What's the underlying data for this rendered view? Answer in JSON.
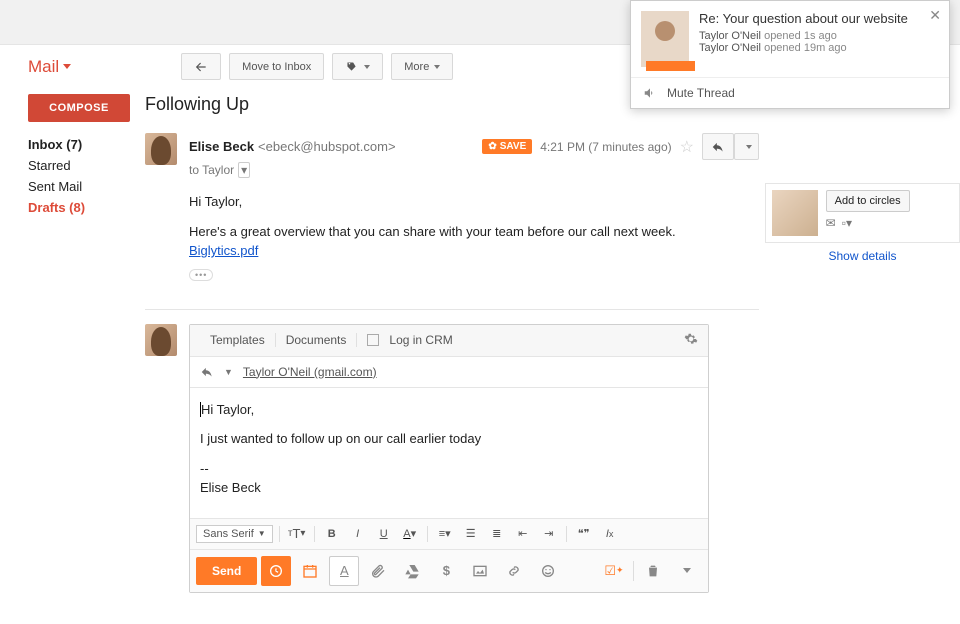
{
  "header": {
    "app": "Mail"
  },
  "toolbar": {
    "back": "←",
    "move_inbox": "Move to Inbox",
    "more": "More"
  },
  "sidebar": {
    "compose": "COMPOSE",
    "items": [
      {
        "label": "Inbox (7)",
        "bold": true
      },
      {
        "label": "Starred"
      },
      {
        "label": "Sent Mail"
      },
      {
        "label": "Drafts (8)",
        "bold": true,
        "red": true
      }
    ]
  },
  "thread": {
    "subject": "Following Up",
    "sender_name": "Elise Beck",
    "sender_email": "<ebeck@hubspot.com>",
    "to": "to Taylor",
    "save_label": "SAVE",
    "time": "4:21 PM (7 minutes ago)",
    "body_greeting": "Hi Taylor,",
    "body_line": "Here's a great overview that you can share with your team before our call next week.",
    "attachment": "Biglytics.pdf"
  },
  "compose": {
    "tabs": {
      "templates": "Templates",
      "documents": "Documents",
      "login": "Log in CRM"
    },
    "recipient": "Taylor O'Neil (gmail.com)",
    "body_greeting": "Hi Taylor,",
    "body_line": "I just wanted to follow up on our call earlier today",
    "sig_sep": "--",
    "sig_name": "Elise Beck",
    "font": "Sans Serif",
    "send": "Send"
  },
  "right": {
    "add_circles": "Add to circles",
    "show_details": "Show details"
  },
  "popover": {
    "title": "Re: Your question about our website",
    "line1_name": "Taylor O'Neil",
    "line1_rest": " opened 1s ago",
    "line2_name": "Taylor O'Neil",
    "line2_rest": " opened 19m ago",
    "mute": "Mute Thread"
  }
}
